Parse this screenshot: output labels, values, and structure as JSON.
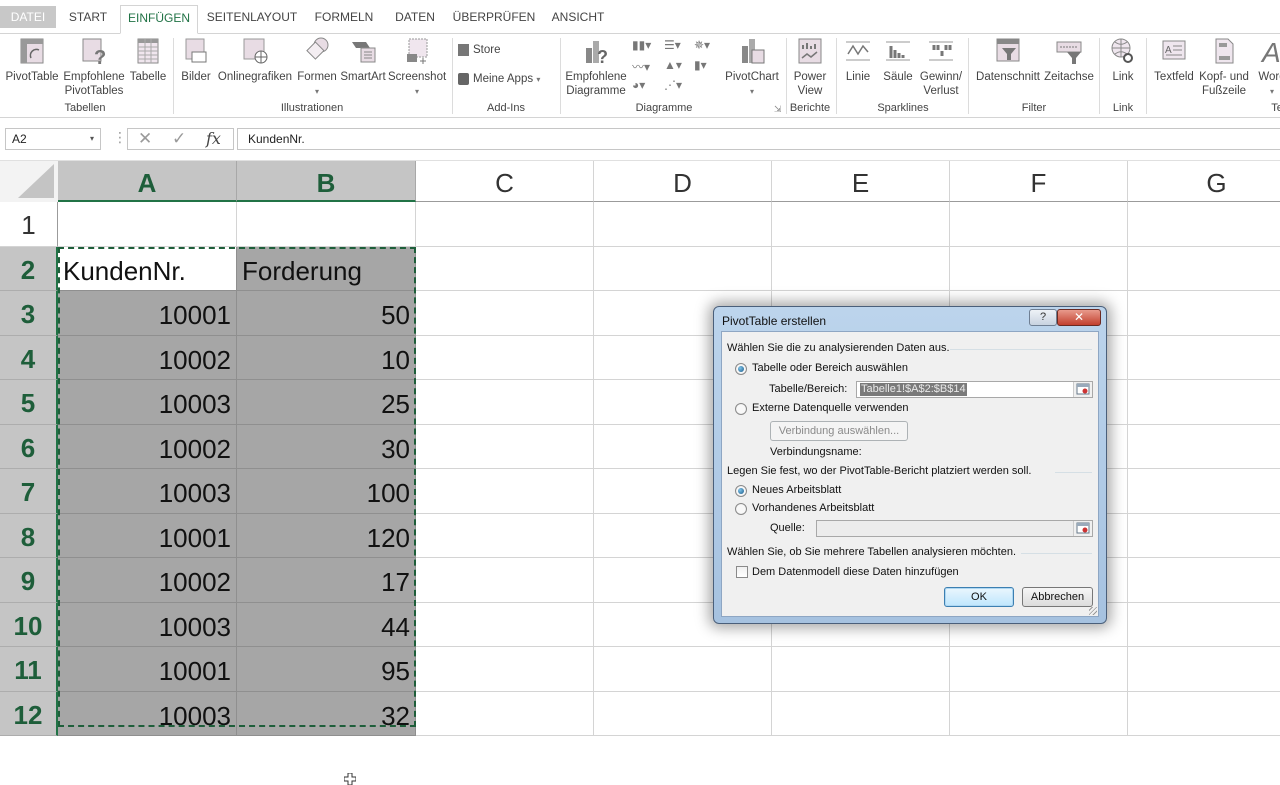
{
  "tabs": [
    {
      "label": "DATEI"
    },
    {
      "label": "START"
    },
    {
      "label": "EINFÜGEN",
      "active": true
    },
    {
      "label": "SEITENLAYOUT"
    },
    {
      "label": "FORMELN"
    },
    {
      "label": "DATEN"
    },
    {
      "label": "ÜBERPRÜFEN"
    },
    {
      "label": "ANSICHT"
    }
  ],
  "ribbon": {
    "groups": {
      "tabellen": "Tabellen",
      "illustrationen": "Illustrationen",
      "addins": "Add-Ins",
      "diagramme": "Diagramme",
      "berichte": "Berichte",
      "sparklines": "Sparklines",
      "filter": "Filter",
      "link": "Link",
      "text": "Te"
    },
    "buttons": {
      "pivottable": "PivotTable",
      "empfohlene_pivot_1": "Empfohlene",
      "empfohlene_pivot_2": "PivotTables",
      "tabelle": "Tabelle",
      "bilder": "Bilder",
      "onlinegrafiken": "Onlinegrafiken",
      "formen": "Formen",
      "smartart": "SmartArt",
      "screenshot": "Screenshot",
      "store": "Store",
      "meine_apps": "Meine Apps",
      "empfohlene_diag_1": "Empfohlene",
      "empfohlene_diag_2": "Diagramme",
      "pivotchart": "PivotChart",
      "power_view_1": "Power",
      "power_view_2": "View",
      "linie": "Linie",
      "saeule": "Säule",
      "gewinn_1": "Gewinn/",
      "gewinn_2": "Verlust",
      "datenschnitt": "Datenschnitt",
      "zeitachse": "Zeitachse",
      "link": "Link",
      "textfeld": "Textfeld",
      "kopf_1": "Kopf- und",
      "kopf_2": "Fußzeile",
      "wordart": "Word"
    }
  },
  "formula_bar": {
    "name_box": "A2",
    "cancel_symbol": "✕",
    "enter_symbol": "✓",
    "fx_symbol": "fx",
    "content": "KundenNr."
  },
  "sheet": {
    "columns": [
      "A",
      "B",
      "C",
      "D",
      "E",
      "F",
      "G"
    ],
    "rows": [
      "1",
      "2",
      "3",
      "4",
      "5",
      "6",
      "7",
      "8",
      "9",
      "10",
      "11",
      "12"
    ],
    "headers": {
      "a": "KundenNr.",
      "b": "Forderung"
    },
    "data": [
      {
        "a": "10001",
        "b": "50"
      },
      {
        "a": "10002",
        "b": "10"
      },
      {
        "a": "10003",
        "b": "25"
      },
      {
        "a": "10002",
        "b": "30"
      },
      {
        "a": "10003",
        "b": "100"
      },
      {
        "a": "10001",
        "b": "120"
      },
      {
        "a": "10002",
        "b": "17"
      },
      {
        "a": "10003",
        "b": "44"
      },
      {
        "a": "10001",
        "b": "95"
      },
      {
        "a": "10003",
        "b": "32"
      }
    ],
    "active_cell": "A2"
  },
  "dialog": {
    "title": "PivotTable erstellen",
    "help": "?",
    "close": "✕",
    "section1": "Wählen Sie die zu analysierenden Daten aus.",
    "radio_table": "Tabelle oder Bereich auswählen",
    "range_label": "Tabelle/Bereich:",
    "range_value": "Tabelle1!$A$2:$B$14",
    "radio_external": "Externe Datenquelle verwenden",
    "connection_button": "Verbindung auswählen...",
    "connection_name_label": "Verbindungsname:",
    "section2": "Legen Sie fest, wo der PivotTable-Bericht platziert werden soll.",
    "radio_new_sheet": "Neues Arbeitsblatt",
    "radio_existing_sheet": "Vorhandenes Arbeitsblatt",
    "source_label": "Quelle:",
    "source_value": "",
    "section3": "Wählen Sie, ob Sie mehrere Tabellen analysieren möchten.",
    "checkbox_datamodel": "Dem Datenmodell diese Daten hinzufügen",
    "checkbox_datamodel_checked": false,
    "selected_source": "table",
    "selected_location": "new_sheet",
    "ok": "OK",
    "cancel": "Abbrechen"
  },
  "colors": {
    "accent": "#217346",
    "selection_fill": "#a6a6a6",
    "header_selected": "#c5c5c5"
  }
}
